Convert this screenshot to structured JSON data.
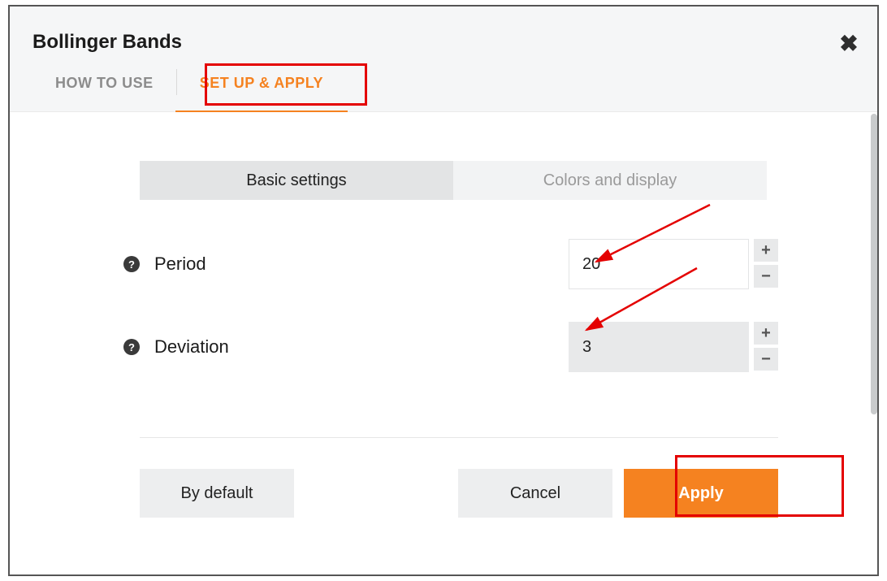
{
  "header": {
    "title": "Bollinger Bands",
    "close_glyph": "✖"
  },
  "tabs": {
    "how_to_use": "HOW TO USE",
    "setup_apply": "SET UP & APPLY"
  },
  "segments": {
    "basic": "Basic settings",
    "colors": "Colors and display"
  },
  "fields": {
    "period": {
      "label": "Period",
      "value": "20",
      "help": "?"
    },
    "deviation": {
      "label": "Deviation",
      "value": "3",
      "help": "?"
    }
  },
  "steppers": {
    "plus": "+",
    "minus": "−"
  },
  "buttons": {
    "default": "By default",
    "cancel": "Cancel",
    "apply": "Apply"
  }
}
